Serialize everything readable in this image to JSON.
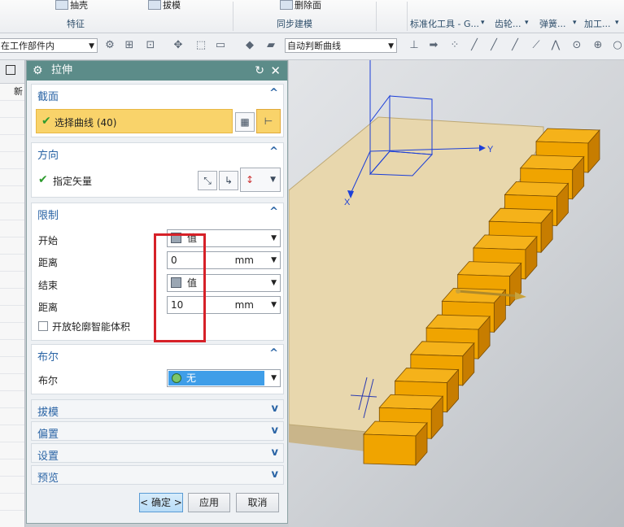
{
  "ribbon": {
    "top_items": [
      "抽壳",
      "拔模",
      "删除面"
    ],
    "groups": [
      "特征",
      "同步建模",
      "标准化工具 - G...",
      "齿轮...",
      "弹簧...",
      "加工..."
    ]
  },
  "toolbar": {
    "scope_combo": "在工作部件内",
    "curve_rule_combo": "自动判断曲线"
  },
  "left_panel": {
    "header_cut": "新"
  },
  "dialog": {
    "title": "拉伸",
    "sections": {
      "section": {
        "label": "截面",
        "select_curve": "选择曲线 (40)"
      },
      "direction": {
        "label": "方向",
        "specify_vector": "指定矢量"
      },
      "limits": {
        "label": "限制",
        "start_label": "开始",
        "start_value": "值",
        "start_distance_label": "距离",
        "start_distance": "0",
        "end_label": "结束",
        "end_value": "值",
        "end_distance_label": "距离",
        "end_distance": "10",
        "unit": "mm",
        "open_profile_label": "开放轮廓智能体积"
      },
      "boolean": {
        "label": "布尔",
        "boolean_label": "布尔",
        "value": "无"
      },
      "draft": "拔模",
      "offset": "偏置",
      "settings": "设置",
      "preview": "预览"
    },
    "buttons": {
      "ok": "< 确定 >",
      "apply": "应用",
      "cancel": "取消"
    }
  },
  "viewport": {
    "axis_y": "Y",
    "axis_x": "X"
  },
  "colors": {
    "title_bar": "#5c8c89",
    "section_label": "#2a64a5",
    "selection_highlight": "#f9d36a",
    "annotation_box": "#d62128",
    "tab_fill": "#f0a400",
    "plate": "#e8d7ad"
  }
}
